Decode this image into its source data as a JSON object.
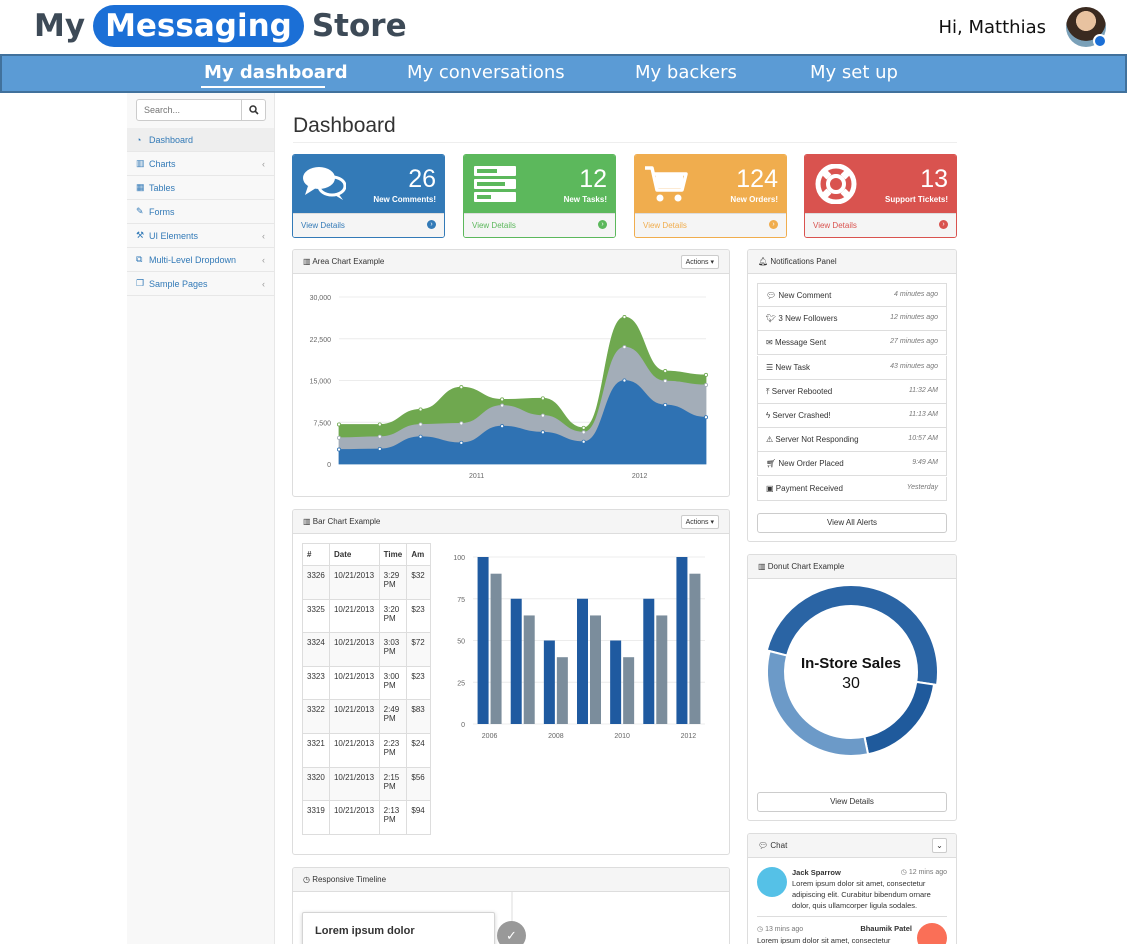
{
  "header": {
    "brand_left": "My",
    "brand_pill": "Messaging",
    "brand_right": "Store",
    "greeting": "Hi, Matthias",
    "avatar_icon": "user-avatar-photo"
  },
  "nav": {
    "items": [
      {
        "label": "My dashboard",
        "active": true
      },
      {
        "label": "My conversations",
        "active": false
      },
      {
        "label": "My backers",
        "active": false
      },
      {
        "label": "My set up",
        "active": false
      }
    ]
  },
  "sidebar": {
    "search_placeholder": "Search...",
    "items": [
      {
        "label": "Dashboard",
        "icon": "dashboard-icon",
        "submenu": false
      },
      {
        "label": "Charts",
        "icon": "bar-chart-icon",
        "submenu": true
      },
      {
        "label": "Tables",
        "icon": "table-icon",
        "submenu": false
      },
      {
        "label": "Forms",
        "icon": "edit-icon",
        "submenu": false
      },
      {
        "label": "UI Elements",
        "icon": "wrench-icon",
        "submenu": true
      },
      {
        "label": "Multi-Level Dropdown",
        "icon": "sitemap-icon",
        "submenu": true
      },
      {
        "label": "Sample Pages",
        "icon": "files-icon",
        "submenu": true
      }
    ]
  },
  "page": {
    "title": "Dashboard"
  },
  "stats": [
    {
      "count": "26",
      "label": "New Comments!",
      "link": "View Details",
      "icon": "comments-icon",
      "color": "#337ab7"
    },
    {
      "count": "12",
      "label": "New Tasks!",
      "link": "View Details",
      "icon": "tasks-icon",
      "color": "#5cb85c"
    },
    {
      "count": "124",
      "label": "New Orders!",
      "link": "View Details",
      "icon": "shopping-cart-icon",
      "color": "#f0ad4e"
    },
    {
      "count": "13",
      "label": "Support Tickets!",
      "link": "View Details",
      "icon": "support-icon",
      "color": "#d9534f"
    }
  ],
  "area_panel": {
    "title": "Area Chart Example",
    "actions": "Actions"
  },
  "bar_panel": {
    "title": "Bar Chart Example",
    "actions": "Actions"
  },
  "timeline_panel": {
    "title": "Responsive Timeline",
    "first_heading": "Lorem ipsum dolor"
  },
  "transactions": {
    "headers": [
      "#",
      "Date",
      "Time",
      "Am"
    ],
    "rows": [
      [
        "3326",
        "10/21/2013",
        "3:29",
        "PM",
        "$32"
      ],
      [
        "3325",
        "10/21/2013",
        "3:20",
        "PM",
        "$23"
      ],
      [
        "3324",
        "10/21/2013",
        "3:03",
        "PM",
        "$72"
      ],
      [
        "3323",
        "10/21/2013",
        "3:00",
        "PM",
        "$23"
      ],
      [
        "3322",
        "10/21/2013",
        "2:49",
        "PM",
        "$83"
      ],
      [
        "3321",
        "10/21/2013",
        "2:23",
        "PM",
        "$24"
      ],
      [
        "3320",
        "10/21/2013",
        "2:15",
        "PM",
        "$56"
      ],
      [
        "3319",
        "10/21/2013",
        "2:13",
        "PM",
        "$94"
      ]
    ]
  },
  "notifications": {
    "title": "Notifications Panel",
    "items": [
      {
        "label": "New Comment",
        "time": "4 minutes ago",
        "icon": "comment-icon"
      },
      {
        "label": "3 New Followers",
        "time": "12 minutes ago",
        "icon": "twitter-icon"
      },
      {
        "label": "Message Sent",
        "time": "27 minutes ago",
        "icon": "envelope-icon"
      },
      {
        "label": "New Task",
        "time": "43 minutes ago",
        "icon": "tasks-icon"
      },
      {
        "label": "Server Rebooted",
        "time": "11:32 AM",
        "icon": "upload-icon"
      },
      {
        "label": "Server Crashed!",
        "time": "11:13 AM",
        "icon": "bolt-icon"
      },
      {
        "label": "Server Not Responding",
        "time": "10:57 AM",
        "icon": "warning-icon"
      },
      {
        "label": "New Order Placed",
        "time": "9:49 AM",
        "icon": "cart-icon"
      },
      {
        "label": "Payment Received",
        "time": "Yesterday",
        "icon": "money-icon"
      }
    ],
    "button": "View All Alerts"
  },
  "donut_panel": {
    "title": "Donut Chart Example",
    "button": "View Details"
  },
  "chat": {
    "title": "Chat",
    "messages": [
      {
        "name": "Jack Sparrow",
        "time": "12 mins ago",
        "text": "Lorem ipsum dolor sit amet, consectetur adipiscing elit. Curabitur bibendum ornare dolor, quis ullamcorper ligula sodales.",
        "side": "left",
        "avatar_color": "#55c1e7"
      },
      {
        "name": "Bhaumik Patel",
        "time": "13 mins ago",
        "text": "Lorem ipsum dolor sit amet, consectetur",
        "side": "right",
        "avatar_color": "#fa6f57"
      }
    ]
  },
  "chart_data": [
    {
      "type": "area",
      "title": "Area Chart Example",
      "xlabel": "",
      "ylabel": "",
      "x_ticks": [
        "2011",
        "2012"
      ],
      "y_ticks": [
        "0",
        "7,500",
        "15,000",
        "22,500",
        "30,000"
      ],
      "ylim": [
        0,
        30000
      ],
      "grid": true,
      "stacked": true,
      "series": [
        {
          "color": "#2f72b3",
          "values": [
            2600,
            2700,
            4900,
            3800,
            6800,
            5700,
            4000,
            15000,
            10600,
            8400
          ]
        },
        {
          "color": "#a3adb8",
          "values": [
            2100,
            2200,
            2200,
            3500,
            3700,
            3000,
            1700,
            6000,
            4300,
            5800
          ]
        },
        {
          "color": "#6fa84f",
          "values": [
            2400,
            2200,
            2700,
            6500,
            1100,
            3100,
            800,
            5400,
            1800,
            1800
          ]
        }
      ]
    },
    {
      "type": "bar",
      "title": "Bar Chart Example",
      "categories": [
        "2006",
        "2007",
        "2008",
        "2009",
        "2010",
        "2011",
        "2012"
      ],
      "x_tick_labels": [
        "2006",
        "",
        "2008",
        "",
        "2010",
        "",
        "2012"
      ],
      "y_ticks": [
        "0",
        "25",
        "50",
        "75",
        "100"
      ],
      "ylim": [
        0,
        100
      ],
      "grid": true,
      "series": [
        {
          "color": "#1f5aa0",
          "values": [
            100,
            75,
            50,
            75,
            50,
            75,
            100
          ]
        },
        {
          "color": "#7b8d9c",
          "values": [
            90,
            65,
            40,
            65,
            40,
            65,
            90
          ]
        }
      ]
    },
    {
      "type": "pie",
      "title": "Donut Chart Example",
      "center_label": "In-Store Sales",
      "center_value": "30",
      "slices": [
        {
          "label": "In-Store Sales",
          "value": 30,
          "color": "#2a64a4"
        },
        {
          "label": "",
          "value": 12,
          "color": "#1f5a9c"
        },
        {
          "label": "",
          "value": 20,
          "color": "#6c9ac8"
        }
      ]
    }
  ]
}
